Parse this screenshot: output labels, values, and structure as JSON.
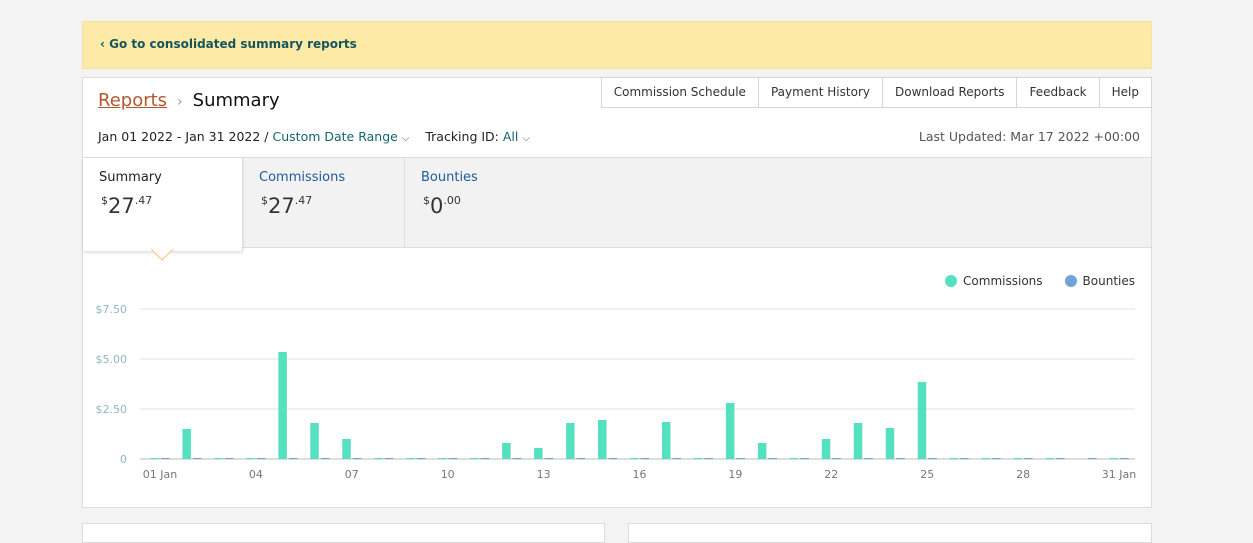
{
  "banner": {
    "link": "‹ Go to consolidated summary reports"
  },
  "breadcrumb": {
    "root": "Reports",
    "separator": "›",
    "current": "Summary"
  },
  "topnav": [
    "Commission Schedule",
    "Payment History",
    "Download Reports",
    "Feedback",
    "Help"
  ],
  "filters": {
    "date_range": "Jan 01 2022 - Jan 31 2022 /",
    "range_type": "Custom Date Range",
    "tracking_label": "Tracking ID:",
    "tracking_value": "All"
  },
  "last_updated": "Last Updated: Mar 17 2022 +00:00",
  "tabs": [
    {
      "label": "Summary",
      "currency": "$",
      "whole": "27",
      "cents": ".47"
    },
    {
      "label": "Commissions",
      "currency": "$",
      "whole": "27",
      "cents": ".47"
    },
    {
      "label": "Bounties",
      "currency": "$",
      "whole": "0",
      "cents": ".00"
    }
  ],
  "icons": {
    "chevron": "chevron-down-icon",
    "pointer": "caret-pointer-icon"
  },
  "colors": {
    "commissions": "#55e0c0",
    "bounties": "#6ea3dc",
    "link": "#16646d",
    "accent": "#b4572e",
    "banner": "#fdeaa7"
  },
  "chart_data": {
    "type": "bar",
    "legend": [
      "Commissions",
      "Bounties"
    ],
    "legend_position": "top-right",
    "grid": true,
    "ylim": [
      0,
      7.5
    ],
    "ytick_labels": [
      "0",
      "$2.50",
      "$5.00",
      "$7.50"
    ],
    "ytick_values": [
      0,
      2.5,
      5,
      7.5
    ],
    "xtick_labels": [
      "01 Jan",
      "04",
      "07",
      "10",
      "13",
      "16",
      "19",
      "22",
      "25",
      "28",
      "31 Jan"
    ],
    "xtick_days": [
      1,
      4,
      7,
      10,
      13,
      16,
      19,
      22,
      25,
      28,
      31
    ],
    "categories": [
      1,
      2,
      3,
      4,
      5,
      6,
      7,
      8,
      9,
      10,
      11,
      12,
      13,
      14,
      15,
      16,
      17,
      18,
      19,
      20,
      21,
      22,
      23,
      24,
      25,
      26,
      27,
      28,
      29,
      30,
      31
    ],
    "series": [
      {
        "name": "Commissions",
        "values": [
          0.05,
          1.5,
          0.05,
          0.05,
          5.35,
          1.8,
          1.0,
          0.05,
          0.05,
          0.05,
          0.05,
          0.8,
          0.55,
          1.8,
          1.95,
          0.05,
          1.85,
          0.05,
          2.8,
          0.8,
          0.05,
          1.0,
          1.8,
          1.55,
          3.85,
          0.05,
          0.05,
          0.05,
          0.05,
          0.0,
          0.05
        ]
      },
      {
        "name": "Bounties",
        "values": [
          0.05,
          0.05,
          0.05,
          0.05,
          0.05,
          0.05,
          0.05,
          0.05,
          0.05,
          0.05,
          0.05,
          0.05,
          0.05,
          0.05,
          0.05,
          0.05,
          0.05,
          0.05,
          0.05,
          0.05,
          0.05,
          0.05,
          0.05,
          0.05,
          0.05,
          0.05,
          0.05,
          0.05,
          0.05,
          0.05,
          0.05
        ]
      }
    ]
  }
}
